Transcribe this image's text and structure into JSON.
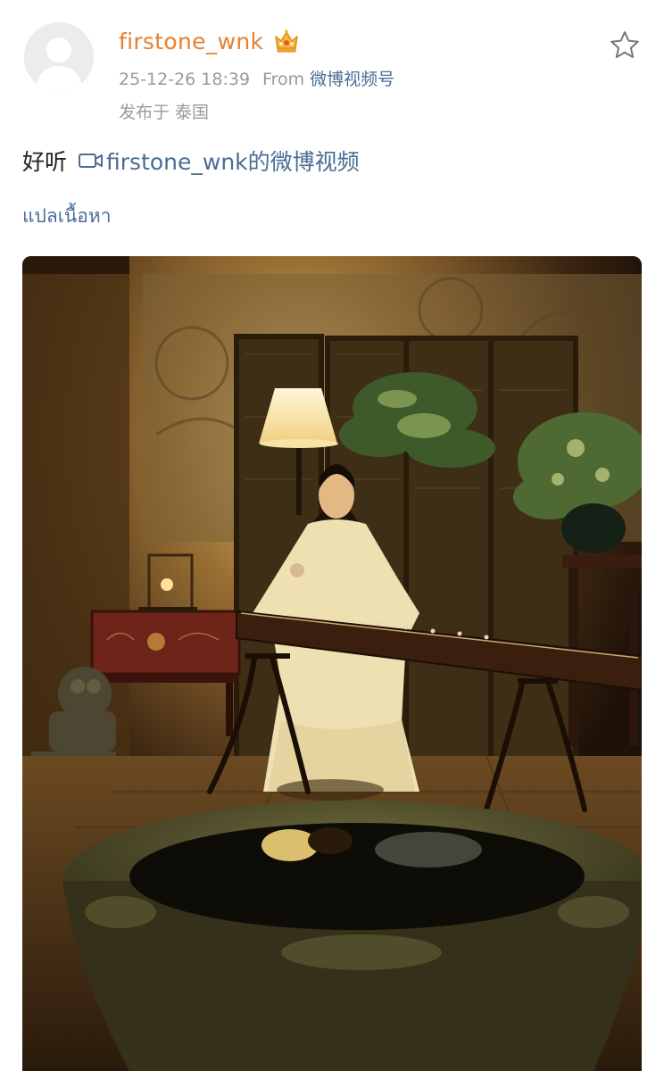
{
  "post": {
    "username": "firstone_wnk",
    "timestamp": "25-12-26 18:39",
    "from_label": "From",
    "source": "微博视频号",
    "location": "发布于 泰国",
    "text": "好听",
    "video_link_label": "firstone_wnk的微博视频",
    "translate_label": "แปลเนื้อหา"
  },
  "icons": {
    "avatar": "default-avatar-icon",
    "badge": "crown-badge-icon",
    "favorite": "star-outline-icon",
    "video": "video-camera-icon"
  },
  "colors": {
    "username": "#e8802d",
    "link": "#4a6d95",
    "meta": "#9a9a9a",
    "text": "#222222"
  }
}
